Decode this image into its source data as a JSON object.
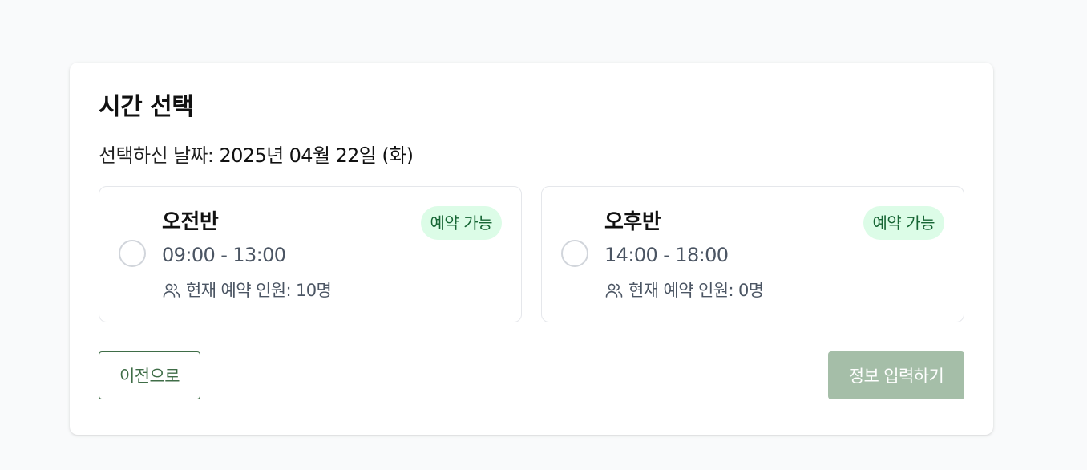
{
  "page": {
    "title": "시간 선택",
    "date_label": "선택하신 날짜: ",
    "date_value": "2025년 04월 22일 (화)"
  },
  "slots": [
    {
      "name": "오전반",
      "time": "09:00 - 13:00",
      "count_text": "현재 예약 인원: 10명",
      "badge": "예약 가능",
      "selected": false
    },
    {
      "name": "오후반",
      "time": "14:00 - 18:00",
      "count_text": "현재 예약 인원: 0명",
      "badge": "예약 가능",
      "selected": false
    }
  ],
  "actions": {
    "prev_label": "이전으로",
    "next_label": "정보 입력하기",
    "next_enabled": false
  },
  "icons": {
    "count_icon": "users-icon"
  },
  "colors": {
    "background": "#f9fafb",
    "primary": "#3f6d47",
    "primary_disabled": "#a5bea8",
    "badge_bg": "#dcfce7",
    "badge_text": "#166534",
    "border": "#e5e7eb"
  }
}
